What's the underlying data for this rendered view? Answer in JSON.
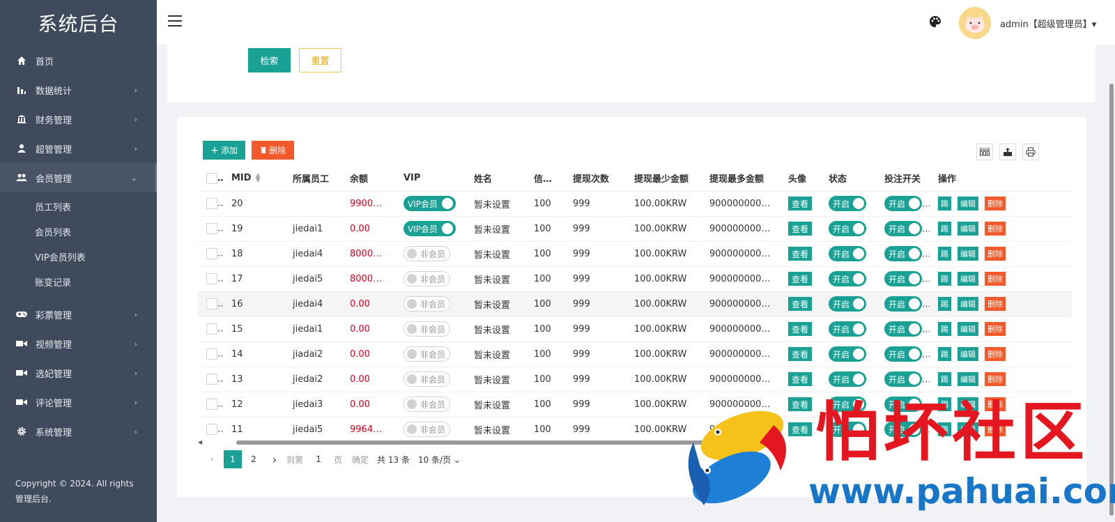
{
  "sidebar": {
    "brand": "系统后台",
    "menu": [
      {
        "label": "首页",
        "icon": "home-icon"
      },
      {
        "label": "数据统计",
        "icon": "bar-chart-icon"
      },
      {
        "label": "财务管理",
        "icon": "bank-icon"
      },
      {
        "label": "超管管理",
        "icon": "user-icon"
      },
      {
        "label": "会员管理",
        "icon": "users-icon"
      }
    ],
    "submenu": [
      "员工列表",
      "会员列表",
      "VIP会员列表",
      "账变记录"
    ],
    "menu_after": [
      {
        "label": "彩票管理",
        "icon": "gamepad-icon"
      },
      {
        "label": "视频管理",
        "icon": "video-icon"
      },
      {
        "label": "选妃管理",
        "icon": "video-icon"
      },
      {
        "label": "评论管理",
        "icon": "video-icon"
      },
      {
        "label": "系统管理",
        "icon": "gear-icon"
      }
    ],
    "copyright": "Copyright © 2024. All rights 管理后台."
  },
  "header": {
    "admin_label": "admin【超级管理员】▾"
  },
  "search": {
    "search_label": "检索",
    "reset_label": "重置"
  },
  "toolbar": {
    "add_label": "添加",
    "delete_label": "删除"
  },
  "table": {
    "columns": [
      "MID",
      "所属员工",
      "余额",
      "VIP",
      "姓名",
      "信…",
      "提现次数",
      "提现最少金额",
      "提现最多金额",
      "头像",
      "状态",
      "投注开关",
      "操作"
    ],
    "rows": [
      {
        "mid": "20",
        "staff": "",
        "balance": "99000…",
        "vip": true,
        "name": "暂未设置",
        "credit": "100",
        "count": "999",
        "min": "100.00KRW",
        "max": "900000000…"
      },
      {
        "mid": "19",
        "staff": "jiedai1",
        "balance": "0.00",
        "vip": true,
        "name": "暂未设置",
        "credit": "100",
        "count": "999",
        "min": "100.00KRW",
        "max": "900000000…"
      },
      {
        "mid": "18",
        "staff": "jiedai4",
        "balance": "80000…",
        "vip": false,
        "name": "暂未设置",
        "credit": "100",
        "count": "999",
        "min": "100.00KRW",
        "max": "900000000…"
      },
      {
        "mid": "17",
        "staff": "jiedai5",
        "balance": "80000…",
        "vip": false,
        "name": "暂未设置",
        "credit": "100",
        "count": "999",
        "min": "100.00KRW",
        "max": "900000000…"
      },
      {
        "mid": "16",
        "staff": "jiedai4",
        "balance": "0.00",
        "vip": false,
        "name": "暂未设置",
        "credit": "100",
        "count": "999",
        "min": "100.00KRW",
        "max": "900000000…"
      },
      {
        "mid": "15",
        "staff": "jiedai1",
        "balance": "0.00",
        "vip": false,
        "name": "暂未设置",
        "credit": "100",
        "count": "999",
        "min": "100.00KRW",
        "max": "900000000…"
      },
      {
        "mid": "14",
        "staff": "jiadai2",
        "balance": "0.00",
        "vip": false,
        "name": "暂未设置",
        "credit": "100",
        "count": "999",
        "min": "100.00KRW",
        "max": "900000000…"
      },
      {
        "mid": "13",
        "staff": "jiedai2",
        "balance": "0.00",
        "vip": false,
        "name": "暂未设置",
        "credit": "100",
        "count": "999",
        "min": "100.00KRW",
        "max": "900000000…"
      },
      {
        "mid": "12",
        "staff": "jiedai3",
        "balance": "0.00",
        "vip": false,
        "name": "暂未设置",
        "credit": "100",
        "count": "999",
        "min": "100.00KRW",
        "max": "900000000…"
      },
      {
        "mid": "11",
        "staff": "jiedai5",
        "balance": "99649…",
        "vip": false,
        "name": "暂未设置",
        "credit": "100",
        "count": "999",
        "min": "100.00KRW",
        "max": "900000000…"
      }
    ],
    "vip_on_label": "VIP会员",
    "vip_off_label": "非会员",
    "view_label": "查看",
    "switch_on_label": "开启",
    "op_kick": "踢",
    "op_edit": "编辑",
    "op_delete": "删除"
  },
  "pagination": {
    "pages": [
      "1",
      "2"
    ],
    "current": "1",
    "goto_label": "到第",
    "goto_value": "1",
    "page_unit": "页",
    "confirm_label": "确定",
    "total_label": "共 13 条",
    "page_size_label": "10 条/页"
  },
  "watermark": {
    "title": "怕坏社区",
    "url": "www.pahuai.com"
  },
  "colors": {
    "sidebar_bg": "#3f4b5d",
    "accent": "#1aa195",
    "danger": "#f3592a",
    "money": "#d9001b"
  }
}
